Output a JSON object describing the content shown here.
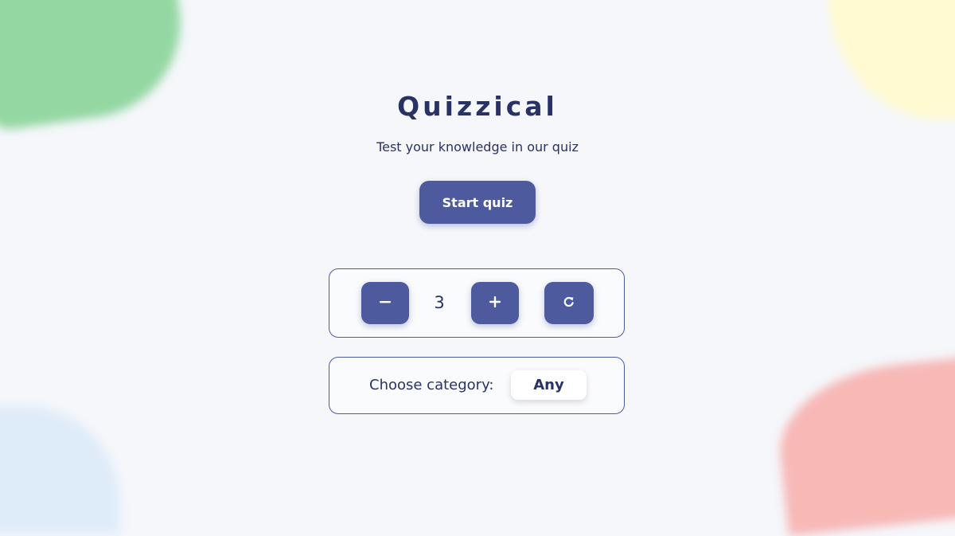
{
  "app": {
    "title": "Quizzical",
    "subtitle": "Test your knowledge in our quiz",
    "start_label": "Start quiz"
  },
  "question_count": {
    "value": "3",
    "decrement_icon": "minus-icon",
    "increment_icon": "plus-icon",
    "reset_icon": "refresh-icon"
  },
  "category": {
    "label": "Choose category:",
    "selected": "Any"
  },
  "colors": {
    "accent": "#4d5b9e",
    "text": "#293264",
    "background": "#f5f7fb"
  }
}
